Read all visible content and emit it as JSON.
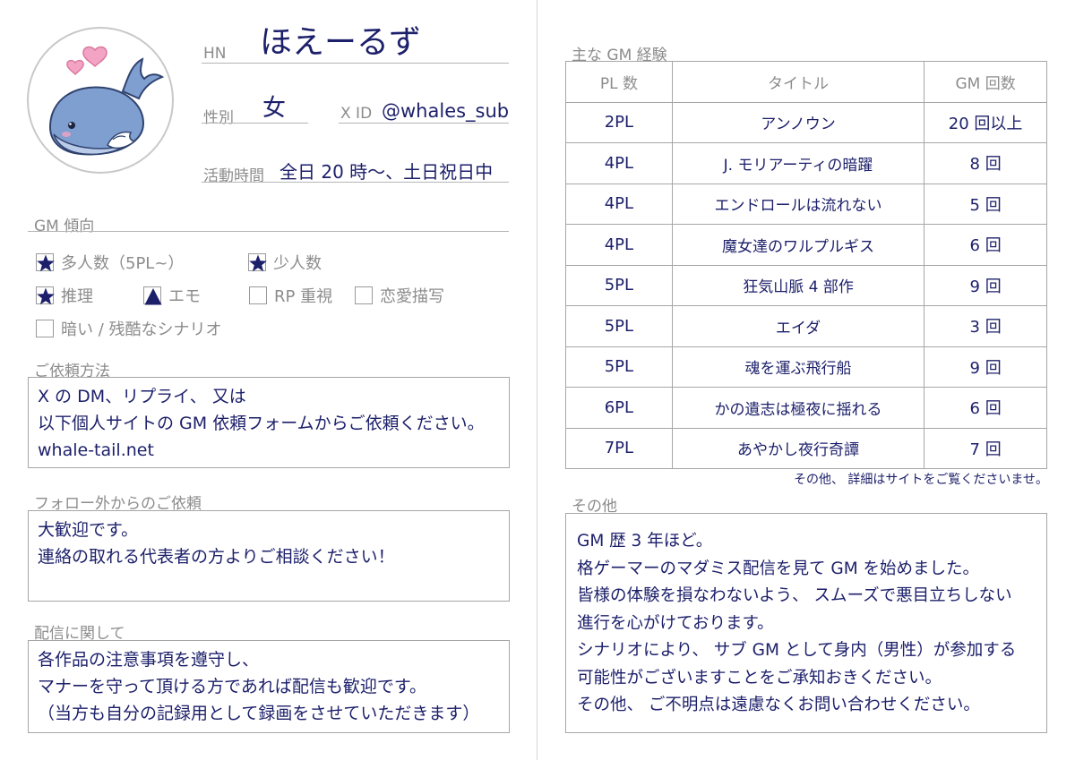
{
  "profile": {
    "hn_label": "HN",
    "hn_value": "ほえーるず",
    "gender_label": "性別",
    "gender_value": "女",
    "xid_label": "X ID",
    "xid_value": "@whales_sub",
    "time_label": "活動時間",
    "time_value": "全日 20 時〜、土日祝日中"
  },
  "gm_tendency": {
    "heading": "GM 傾向",
    "options": [
      {
        "label": "多人数（5PL~）",
        "mark": "star"
      },
      {
        "label": "少人数",
        "mark": "star"
      },
      {
        "label": "推理",
        "mark": "star"
      },
      {
        "label": "エモ",
        "mark": "triangle"
      },
      {
        "label": "RP 重視",
        "mark": "none"
      },
      {
        "label": "恋愛描写",
        "mark": "none"
      },
      {
        "label": "暗い / 残酷なシナリオ",
        "mark": "none"
      }
    ]
  },
  "request": {
    "heading": "ご依頼方法",
    "lines": [
      "X の DM、リプライ、 又は",
      "以下個人サイトの GM 依頼フォームからご依頼ください。",
      "whale-tail.net"
    ]
  },
  "follow": {
    "heading": "フォロー外からのご依頼",
    "lines": [
      "大歓迎です。",
      "連絡の取れる代表者の方よりご相談ください！"
    ]
  },
  "stream": {
    "heading": "配信に関して",
    "lines": [
      "各作品の注意事項を遵守し、",
      "マナーを守って頂ける方であれば配信も歓迎です。",
      "（当方も自分の記録用として録画をさせていただきます）"
    ]
  },
  "experience": {
    "heading": "主な GM 経験",
    "columns": [
      "PL 数",
      "タイトル",
      "GM 回数"
    ],
    "rows": [
      {
        "pl": "2PL",
        "title": "アンノウン",
        "count": "20 回以上"
      },
      {
        "pl": "4PL",
        "title": "J. モリアーティの暗躍",
        "count": "8 回"
      },
      {
        "pl": "4PL",
        "title": "エンドロールは流れない",
        "count": "5 回"
      },
      {
        "pl": "4PL",
        "title": "魔女達のワルプルギス",
        "count": "6 回"
      },
      {
        "pl": "5PL",
        "title": "狂気山脈 4 部作",
        "count": "9 回"
      },
      {
        "pl": "5PL",
        "title": "エイダ",
        "count": "3 回"
      },
      {
        "pl": "5PL",
        "title": "魂を運ぶ飛行船",
        "count": "9 回"
      },
      {
        "pl": "6PL",
        "title": "かの遺志は極夜に揺れる",
        "count": "6 回"
      },
      {
        "pl": "7PL",
        "title": "あやかし夜行奇譚",
        "count": "7 回"
      }
    ],
    "note": "その他、 詳細はサイトをご覧くださいませ。"
  },
  "other": {
    "heading": "その他",
    "lines": [
      "GM 歴 3 年ほど。",
      "格ゲーマーのマダミス配信を見て GM を始めました。",
      "皆様の体験を損なわないよう、 スムーズで悪目立ちしない",
      "進行を心がけております。",
      "シナリオにより、 サブ GM として身内（男性）が参加する",
      "可能性がございますことをご承知おきください。",
      "その他、 ご不明点は遠慮なくお問い合わせください。"
    ]
  },
  "colors": {
    "text": "#1c1f6a",
    "label": "#8c8c8c",
    "whale": "#7f9fd0",
    "heart": "#f3a3c4"
  }
}
